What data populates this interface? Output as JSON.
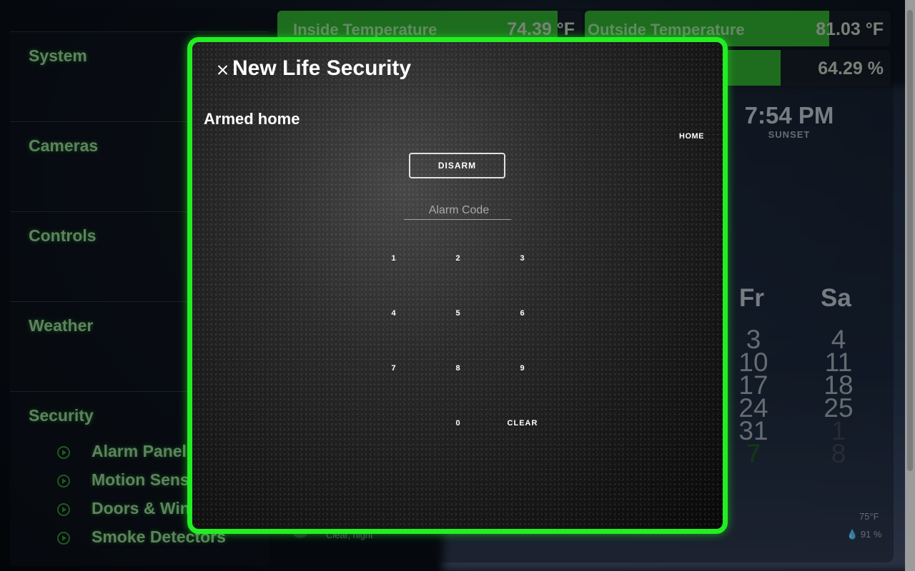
{
  "sidebar": {
    "sections": [
      {
        "title": "System"
      },
      {
        "title": "Cameras"
      },
      {
        "title": "Controls"
      },
      {
        "title": "Weather"
      },
      {
        "title": "Security",
        "items": [
          "Alarm Panel",
          "Motion Sensors",
          "Doors & Windows",
          "Smoke Detectors"
        ]
      }
    ]
  },
  "sensors": {
    "inside": {
      "label": "Inside Temperature",
      "value": "74.39 °F",
      "level": 0.92
    },
    "outside": {
      "label": "Outside Temperature",
      "value": "81.03 °F",
      "level": 0.8
    },
    "humidity": {
      "label": "",
      "value": "64.29 %",
      "level": 0.64
    }
  },
  "sun": {
    "time": "7:54 PM",
    "label": "SUNSET"
  },
  "calendar": {
    "days": [
      "Fr",
      "Sa"
    ],
    "fr": [
      "3",
      "10",
      "17",
      "24",
      "31",
      "7"
    ],
    "sa": [
      "4",
      "11",
      "18",
      "25",
      "1",
      "8"
    ]
  },
  "weather": {
    "temp": "75°F",
    "humidity": "91 %",
    "condition": "Clear, night"
  },
  "modal": {
    "title": "New Life Security",
    "state": "Armed home",
    "mode": "HOME",
    "disarm_label": "DISARM",
    "code_placeholder": "Alarm Code",
    "keys": [
      "1",
      "2",
      "3",
      "4",
      "5",
      "6",
      "7",
      "8",
      "9",
      "0",
      "CLEAR"
    ]
  },
  "colors": {
    "accent": "#22ee22",
    "sensor_fill": "#2fa82f",
    "label_green": "#8fc98f"
  }
}
